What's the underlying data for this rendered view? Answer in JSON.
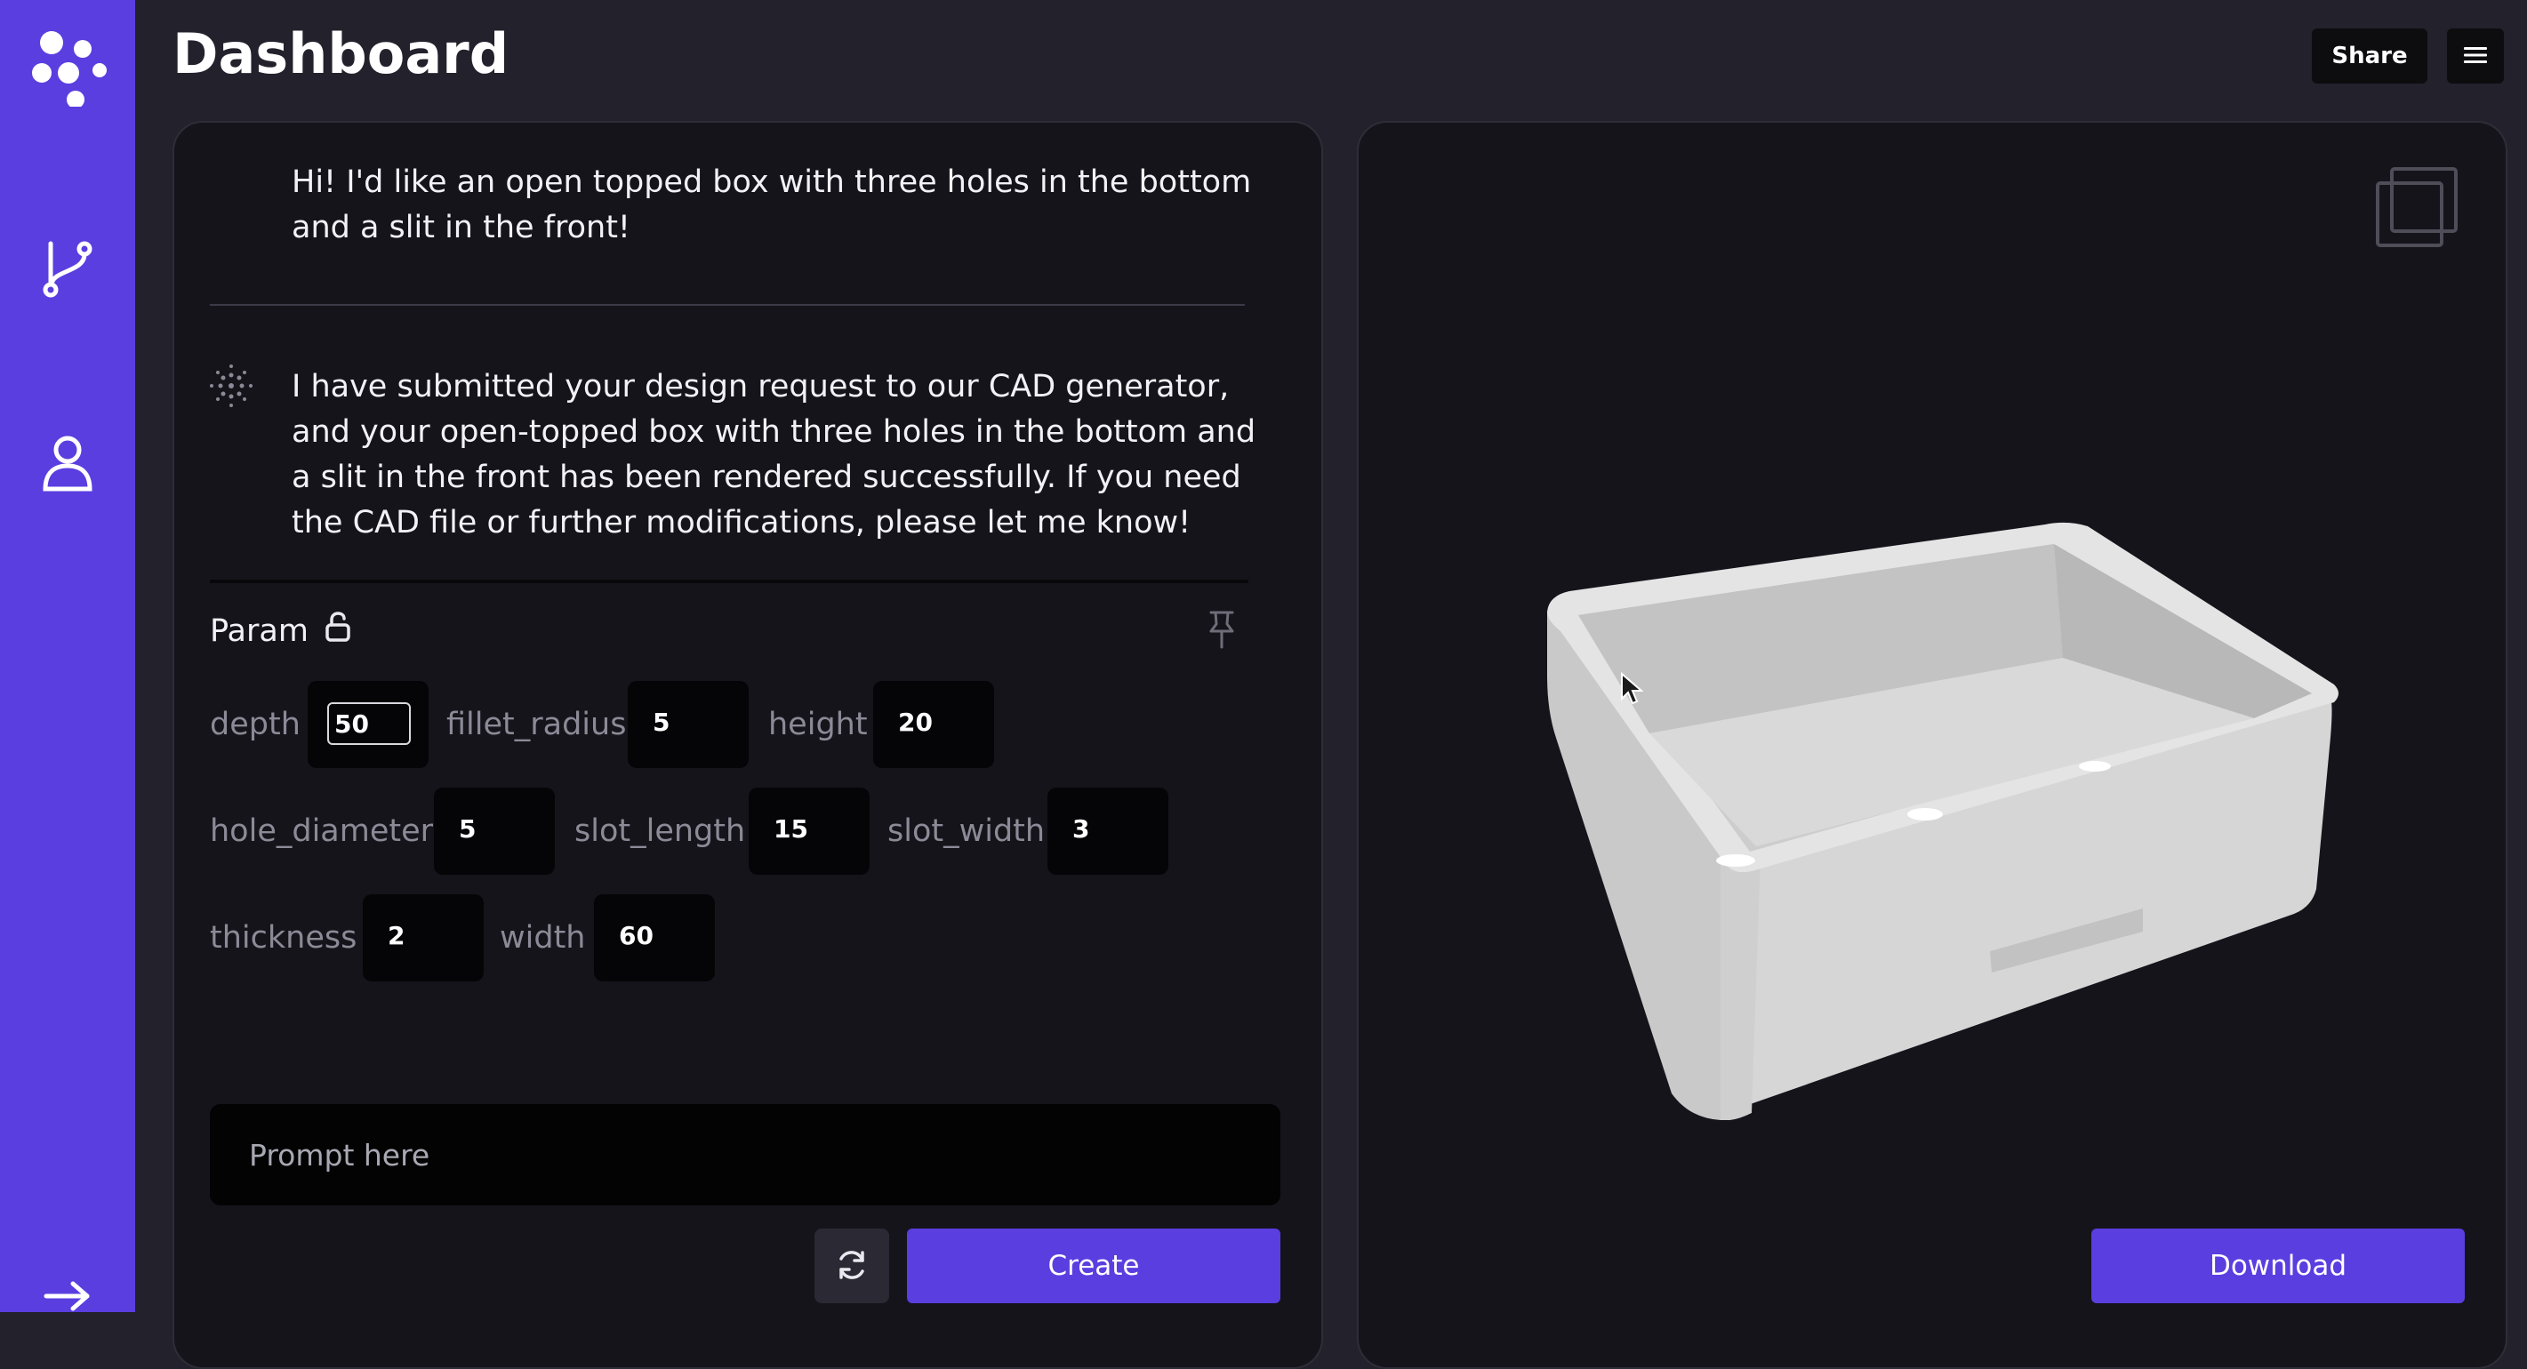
{
  "header": {
    "title": "Dashboard",
    "share_label": "Share",
    "menu_icon": "hamburger-menu-icon"
  },
  "sidebar": {
    "items": [
      {
        "icon": "logo-dots-icon"
      },
      {
        "icon": "git-branch-icon"
      },
      {
        "icon": "user-icon"
      },
      {
        "icon": "arrow-right-icon"
      }
    ]
  },
  "chat": {
    "user_message": "Hi! I'd like an open topped box with three holes in the bottom and a slit in the front!",
    "assistant_message": "I have submitted your design request to our CAD generator, and your open-topped box with three holes in the bottom and a slit in the front has been rendered successfully. If you need the CAD file or further modifications, please let me know!"
  },
  "params": {
    "title": "Param",
    "lock_icon": "lock-open-icon",
    "pin_icon": "pin-icon",
    "items": [
      {
        "label": "depth",
        "value": "50"
      },
      {
        "label": "fillet_radius",
        "value": "5"
      },
      {
        "label": "height",
        "value": "20"
      },
      {
        "label": "hole_diameter",
        "value": "5"
      },
      {
        "label": "slot_length",
        "value": "15"
      },
      {
        "label": "slot_width",
        "value": "3"
      },
      {
        "label": "thickness",
        "value": "2"
      },
      {
        "label": "width",
        "value": "60"
      }
    ]
  },
  "composer": {
    "placeholder": "Prompt here",
    "refresh_icon": "refresh-icon",
    "create_label": "Create"
  },
  "viewer": {
    "fullscreen_icon": "fullscreen-icon",
    "download_label": "Download"
  },
  "colors": {
    "accent": "#5a3ee0",
    "background": "#22212c",
    "panel": "#15141b"
  }
}
